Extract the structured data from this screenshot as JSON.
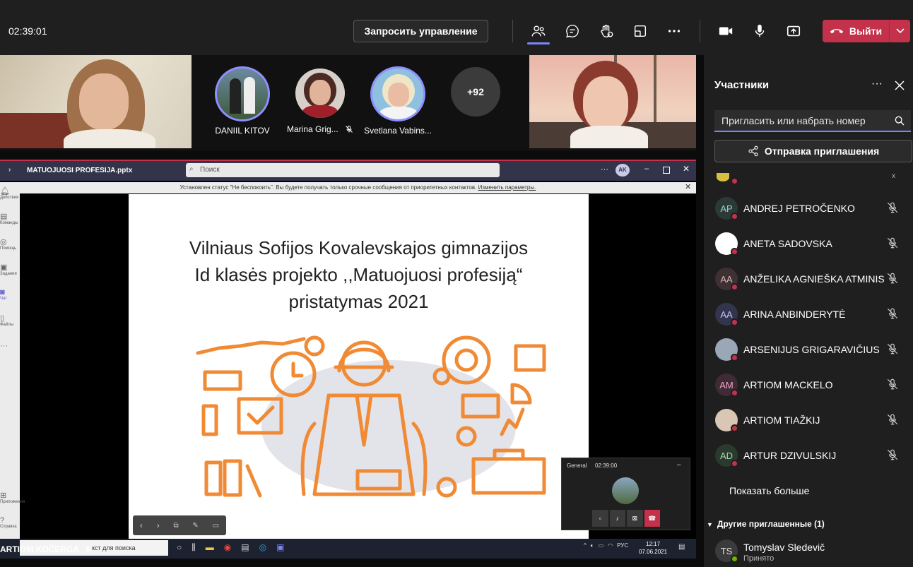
{
  "topbar": {
    "timer": "02:39:01",
    "request_control": "Запросить управление",
    "leave": "Выйти"
  },
  "strip": {
    "participants": [
      {
        "name": "DANIIL KITOV"
      },
      {
        "name": "Marina Grig..."
      },
      {
        "name": "Svetlana Vabins..."
      }
    ],
    "overflow_count": "+92"
  },
  "share": {
    "window_title": "MATUOJUOSI PROFESIJA.pptx",
    "search_placeholder": "Поиск",
    "user_initials": "AK",
    "notice": "Установлен статус \"Не беспокоить\". Вы будете получать только срочные сообщения от приоритетных контактов.",
    "notice_link": "Изменить параметры.",
    "rail": [
      "Действия",
      "Команды",
      "Помощь",
      "Задания",
      "Чат",
      "Файлы",
      "Приложения",
      "Справка"
    ],
    "slide_title_lines": [
      "Vilniaus Sofijos Kovalevskajos gimnazijos",
      "Id klasės projekto ,,Matuojuosi profesiją“",
      "pristatymas  2021"
    ],
    "mini_call": {
      "label": "General",
      "time": "02:39:00"
    },
    "taskbar": {
      "search_text": "кст для поиска",
      "presenter": "ARTIOM KOČERGA",
      "lang": "РУС",
      "time": "12:17",
      "date": "07.06.2021"
    }
  },
  "panel": {
    "title": "Участники",
    "invite_placeholder": "Пригласить или набрать номер",
    "send_invite": "Отправка приглашения",
    "participants": [
      {
        "initials": "AP",
        "name": "ANDREJ PETROČENKO",
        "bg": "#2b3a37",
        "fg": "#9fd3c7"
      },
      {
        "initials": "",
        "name": "ANETA SADOVSKA",
        "bg": "#ffffff",
        "fg": "#000"
      },
      {
        "initials": "AA",
        "name": "ANŽELIKA AGNIEŠKA ATMINIS",
        "bg": "#3e3033",
        "fg": "#d8b6bc"
      },
      {
        "initials": "AA",
        "name": "ARINA ANBINDERYTĖ",
        "bg": "#34344c",
        "fg": "#c4c6ff"
      },
      {
        "initials": "",
        "name": "ARSENIJUS GRIGARAVIČIUS",
        "bg": "#9aa7b6",
        "fg": "#000"
      },
      {
        "initials": "AM",
        "name": "ARTIOM MACKELO",
        "bg": "#3e2b35",
        "fg": "#f2a5c3"
      },
      {
        "initials": "",
        "name": "ARTIOM TIAŽKIJ",
        "bg": "#d9c6b5",
        "fg": "#000"
      },
      {
        "initials": "AD",
        "name": "ARTUR DZIVULSKIJ",
        "bg": "#2b3a2e",
        "fg": "#a7d8ae"
      }
    ],
    "show_more": "Показать больше",
    "other_invited": "Другие приглашенные (1)",
    "invited": {
      "initials": "TS",
      "name": "Tomyslav Sledevič",
      "status": "Принято"
    }
  }
}
